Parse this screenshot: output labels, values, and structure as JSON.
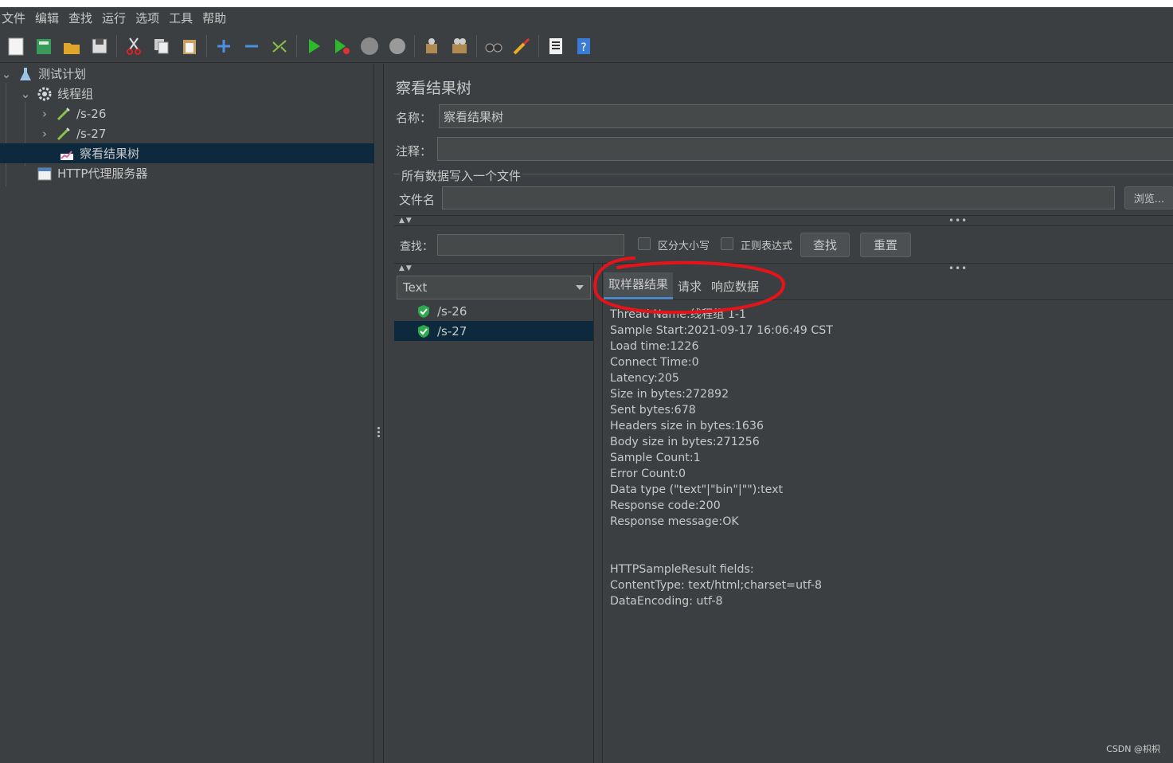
{
  "menu": [
    "文件",
    "编辑",
    "查找",
    "运行",
    "选项",
    "工具",
    "帮助"
  ],
  "toolbar_icons": [
    "new-icon",
    "templates-icon",
    "open-icon",
    "save-icon",
    "cut-icon",
    "copy-icon",
    "paste-icon",
    "expand-icon",
    "collapse-icon",
    "toggle-icon",
    "start-icon",
    "start-no-pause-icon",
    "stop-icon",
    "shutdown-icon",
    "clear-icon",
    "clear-all-icon",
    "search-icon",
    "reset-search-icon",
    "function-helper-icon",
    "help-icon"
  ],
  "tree": {
    "plan": "测试计划",
    "thread_group": "线程组",
    "sampler1": "/s-26",
    "sampler2": "/s-27",
    "listener": "察看结果树",
    "proxy": "HTTP代理服务器"
  },
  "panel": {
    "title": "察看结果树",
    "name_label": "名称：",
    "name_value": "察看结果树",
    "comment_label": "注释：",
    "group_title": "所有数据写入一个文件",
    "filename_label": "文件名",
    "browse_label": "浏览...",
    "search_label": "查找：",
    "case_label": "区分大小写",
    "regex_label": "正则表达式",
    "find_button": "查找",
    "reset_button": "重置"
  },
  "renderer": {
    "selected": "Text"
  },
  "results": [
    "/s-26",
    "/s-27"
  ],
  "tabs": [
    "取样器结果",
    "请求",
    "响应数据"
  ],
  "details": [
    "Thread Name:线程组 1-1",
    "Sample Start:2021-09-17 16:06:49 CST",
    "Load time:1226",
    "Connect Time:0",
    "Latency:205",
    "Size in bytes:272892",
    "Sent bytes:678",
    "Headers size in bytes:1636",
    "Body size in bytes:271256",
    "Sample Count:1",
    "Error Count:0",
    "Data type (\"text\"|\"bin\"|\"\"):text",
    "Response code:200",
    "Response message:OK",
    "",
    "",
    "HTTPSampleResult fields:",
    "ContentType: text/html;charset=utf-8",
    "DataEncoding: utf-8"
  ],
  "watermark": "CSDN @枳枳",
  "colors": {
    "background": "#3c3f41",
    "selection": "#0d293e",
    "annotation": "#e5141b",
    "tab_underline": "#4a88c7"
  }
}
